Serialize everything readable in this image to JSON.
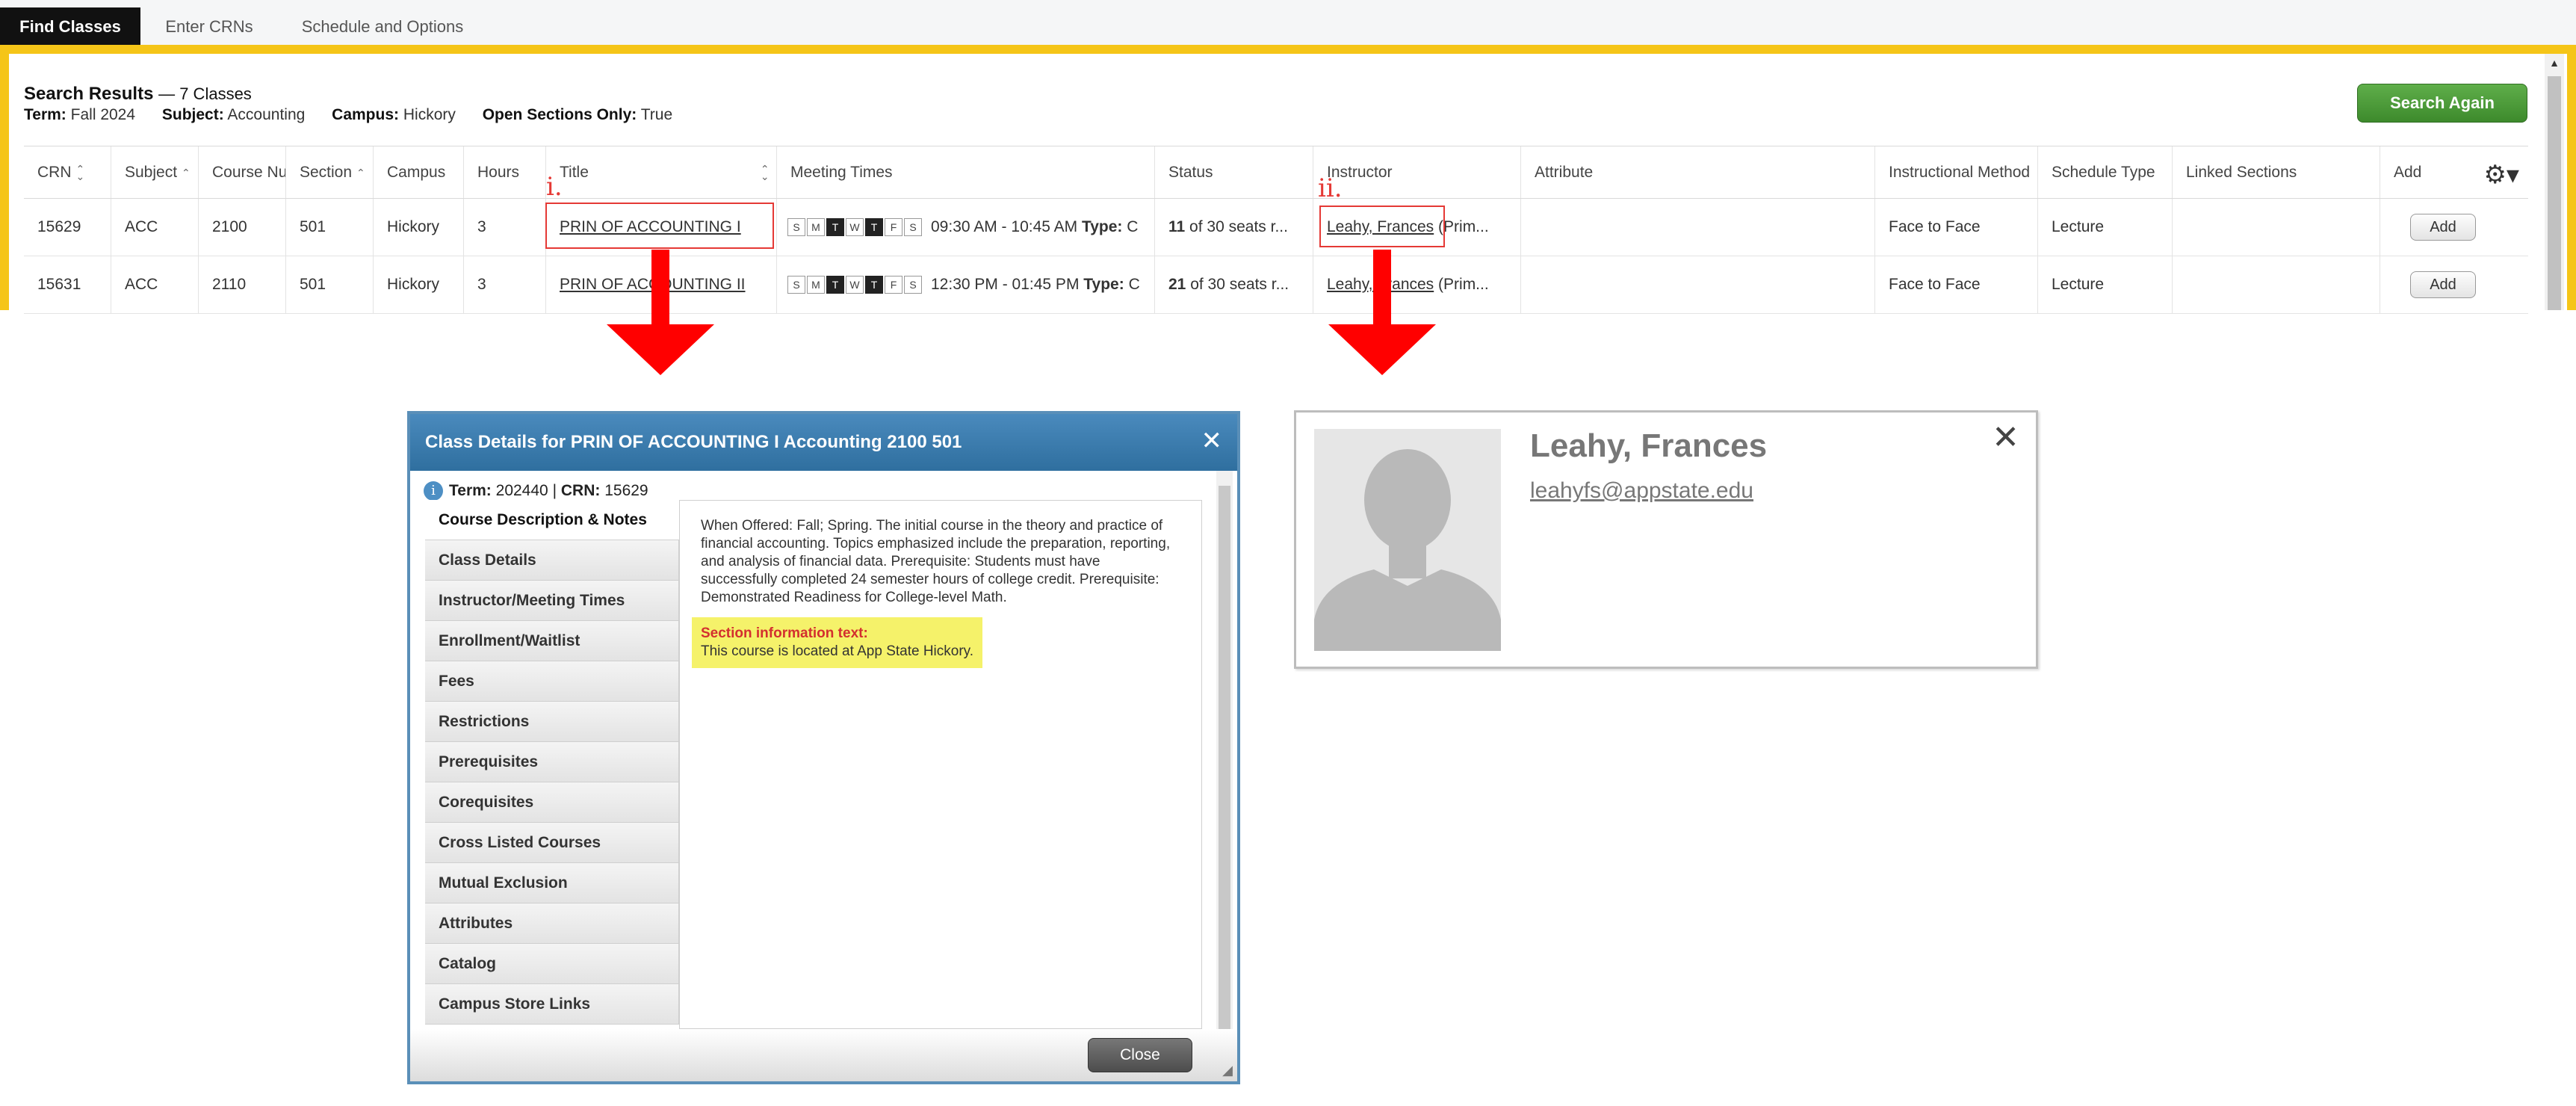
{
  "tabs": [
    "Find Classes",
    "Enter CRNs",
    "Schedule and Options"
  ],
  "search": {
    "title": "Search Results",
    "count": "— 7 Classes",
    "criteria": [
      {
        "label": "Term:",
        "value": "Fall 2024"
      },
      {
        "label": "Subject:",
        "value": "Accounting"
      },
      {
        "label": "Campus:",
        "value": "Hickory"
      },
      {
        "label": "Open Sections Only:",
        "value": "True"
      }
    ],
    "search_again_label": "Search Again"
  },
  "table": {
    "headers": [
      "CRN",
      "Subject",
      "Course Nu",
      "Section",
      "Campus",
      "Hours",
      "Title",
      "Meeting Times",
      "Status",
      "Instructor",
      "Attribute",
      "Instructional Method",
      "Schedule Type",
      "Linked Sections",
      "Add"
    ],
    "rows": [
      {
        "crn": "15629",
        "subject": "ACC",
        "course": "2100",
        "section": "501",
        "campus": "Hickory",
        "hours": "3",
        "title": "PRIN OF ACCOUNTING I",
        "days": [
          "S",
          "M",
          "T",
          "W",
          "T",
          "F",
          "S"
        ],
        "days_on": [
          2,
          4
        ],
        "time": "09:30 AM - 10:45 AM",
        "type_label": "Type:",
        "type_tail": "C",
        "seats_bold": "11",
        "seats": "of 30 seats r...",
        "instructor": "Leahy, Frances",
        "instructor_tail": "(Prim...",
        "method": "Face to Face",
        "schedule": "Lecture",
        "add_label": "Add"
      },
      {
        "crn": "15631",
        "subject": "ACC",
        "course": "2110",
        "section": "501",
        "campus": "Hickory",
        "hours": "3",
        "title": "PRIN OF ACCOUNTING II",
        "days": [
          "S",
          "M",
          "T",
          "W",
          "T",
          "F",
          "S"
        ],
        "days_on": [
          2,
          4
        ],
        "time": "12:30 PM - 01:45 PM",
        "type_label": "Type:",
        "type_tail": "C",
        "seats_bold": "21",
        "seats": "of 30 seats r...",
        "instructor": "Leahy, Frances",
        "instructor_tail": "(Prim...",
        "method": "Face to Face",
        "schedule": "Lecture",
        "add_label": "Add"
      }
    ]
  },
  "annotations": {
    "first": "i.",
    "second": "ii."
  },
  "dialog": {
    "title": "Class Details for PRIN OF ACCOUNTING I Accounting 2100 501",
    "term_label": "Term:",
    "term": "202440",
    "separator": "|",
    "crn_label": "CRN:",
    "crn": "15629",
    "sections": [
      "Course Description & Notes",
      "Class Details",
      "Instructor/Meeting Times",
      "Enrollment/Waitlist",
      "Fees",
      "Restrictions",
      "Prerequisites",
      "Corequisites",
      "Cross Listed Courses",
      "Mutual Exclusion",
      "Attributes",
      "Catalog",
      "Campus Store Links"
    ],
    "description": "When Offered: Fall; Spring. The initial course in the theory and practice of financial accounting. Topics emphasized include the preparation, reporting, and analysis of financial data. Prerequisite: Students must have successfully completed 24 semester hours of college credit. Prerequisite: Demonstrated Readiness for College-level Math.",
    "note_label": "Section information text:",
    "note_text": "This course is located at App State Hickory.",
    "close_label": "Close"
  },
  "instructor_card": {
    "name": "Leahy, Frances",
    "email": "leahyfs@appstate.edu"
  },
  "colors": {
    "accent_yellow": "#f5c518",
    "annotation_red": "#e53935",
    "dialog_blue": "#2f6f9f",
    "button_green": "#3d8a2c"
  }
}
